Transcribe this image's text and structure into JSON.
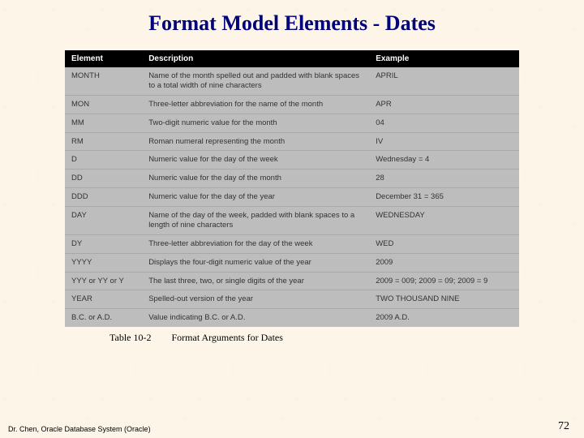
{
  "title": "Format Model Elements - Dates",
  "table": {
    "headers": [
      "Element",
      "Description",
      "Example"
    ],
    "rows": [
      {
        "element": "MONTH",
        "description": "Name of the month spelled out and padded with blank spaces to a total width of nine characters",
        "example": "APRIL"
      },
      {
        "element": "MON",
        "description": "Three-letter abbreviation for the name of the month",
        "example": "APR"
      },
      {
        "element": "MM",
        "description": "Two-digit numeric value for the month",
        "example": "04"
      },
      {
        "element": "RM",
        "description": "Roman numeral representing the month",
        "example": "IV"
      },
      {
        "element": "D",
        "description": "Numeric value for the day of the week",
        "example": "Wednesday = 4"
      },
      {
        "element": "DD",
        "description": "Numeric value for the day of the month",
        "example": "28"
      },
      {
        "element": "DDD",
        "description": "Numeric value for the day of the year",
        "example": "December 31 = 365"
      },
      {
        "element": "DAY",
        "description": "Name of the day of the week, padded with blank spaces to a length of nine characters",
        "example": "WEDNESDAY"
      },
      {
        "element": "DY",
        "description": "Three-letter abbreviation for the day of the week",
        "example": "WED"
      },
      {
        "element": "YYYY",
        "description": "Displays the four-digit numeric value of the year",
        "example": "2009"
      },
      {
        "element": "YYY or YY or Y",
        "description": "The last three, two, or single digits of the year",
        "example": "2009 = 009; 2009 = 09; 2009 = 9"
      },
      {
        "element": "YEAR",
        "description": "Spelled-out version of the year",
        "example": "TWO THOUSAND NINE"
      },
      {
        "element": "B.C. or A.D.",
        "description": "Value indicating B.C. or A.D.",
        "example": "2009 A.D."
      }
    ]
  },
  "caption": {
    "number": "Table 10-2",
    "text": "Format Arguments for Dates"
  },
  "footer": {
    "left": "Dr. Chen, Oracle Database System (Oracle)",
    "page": "72"
  }
}
